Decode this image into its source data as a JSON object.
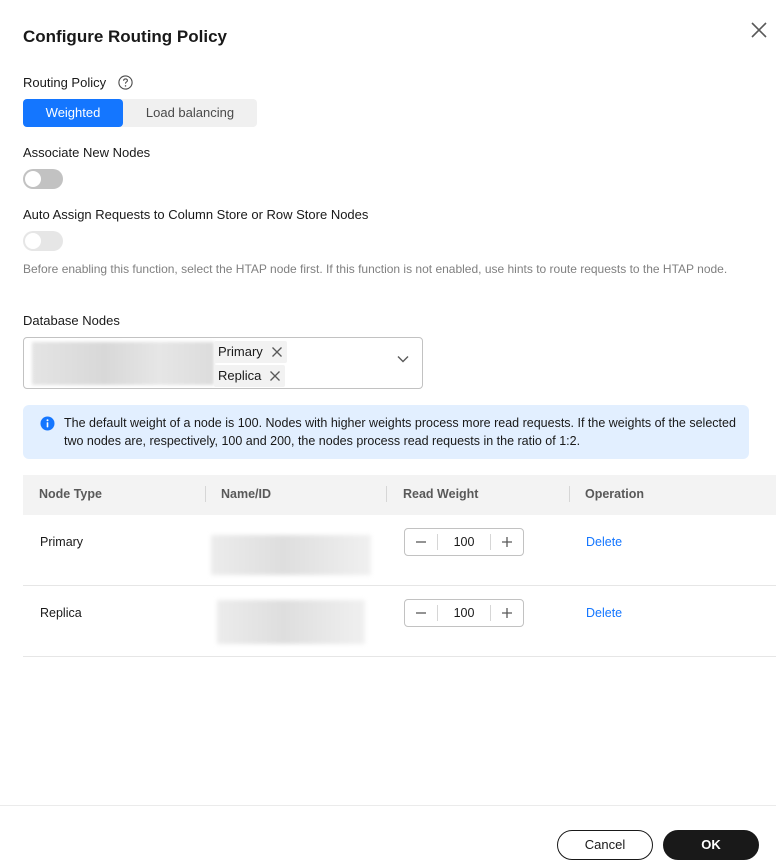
{
  "dialog": {
    "title": "Configure Routing Policy",
    "close_icon": "close-icon"
  },
  "routing_policy": {
    "label": "Routing Policy",
    "help_icon": "question-circle-icon",
    "options": [
      "Weighted",
      "Load balancing"
    ],
    "selected": "Weighted"
  },
  "associate_new_nodes": {
    "label": "Associate New Nodes",
    "enabled": false
  },
  "auto_assign": {
    "label": "Auto Assign Requests to Column Store or Row Store Nodes",
    "enabled": false,
    "hint": "Before enabling this function, select the HTAP node first. If this function is not enabled, use hints to route requests to the HTAP node."
  },
  "database_nodes": {
    "label": "Database Nodes",
    "tags": [
      "Primary",
      "Replica"
    ],
    "dropdown_icon": "chevron-down-icon"
  },
  "info": {
    "icon": "info-circle-icon",
    "text": "The default weight of a node is 100. Nodes with higher weights process more read requests. If the weights of the selected two nodes are, respectively, 100 and 200, the nodes process read requests in the ratio of 1:2."
  },
  "table": {
    "headers": [
      "Node Type",
      "Name/ID",
      "Read Weight",
      "Operation"
    ],
    "rows": [
      {
        "node_type": "Primary",
        "read_weight": "100",
        "operation": "Delete"
      },
      {
        "node_type": "Replica",
        "read_weight": "100",
        "operation": "Delete"
      }
    ]
  },
  "footer": {
    "cancel_label": "Cancel",
    "ok_label": "OK"
  },
  "colors": {
    "accent": "#1476ff",
    "info_bg": "#e2efff",
    "primary_button": "#191919"
  }
}
